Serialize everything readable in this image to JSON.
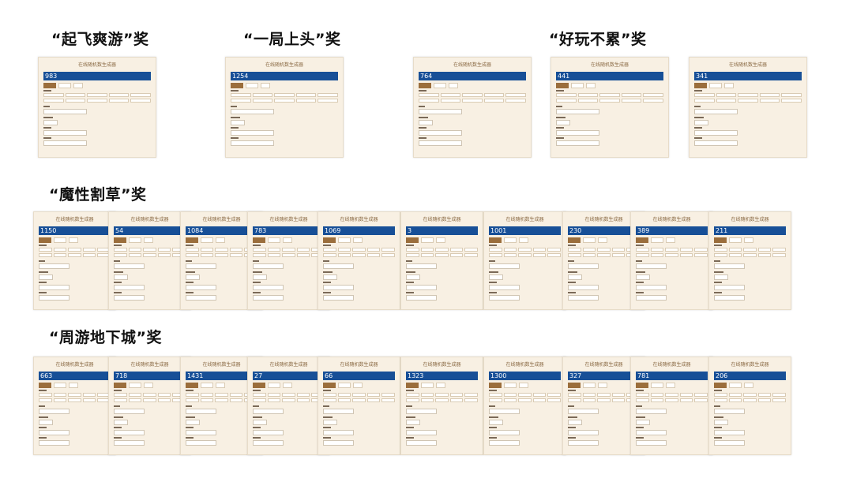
{
  "card_title": "在线随机数生成器",
  "groups": [
    {
      "name": "“起飞爽游”奖",
      "values": [
        "983"
      ]
    },
    {
      "name": "“一局上头”奖",
      "values": [
        "1254"
      ]
    },
    {
      "name": "“好玩不累”奖",
      "values": [
        "764",
        "441",
        "341"
      ]
    },
    {
      "name": "“魔性割草”奖",
      "values": [
        "1150",
        "54",
        "1084",
        "783",
        "1069",
        "3",
        "1001",
        "230",
        "389",
        "211"
      ]
    },
    {
      "name": "“周游地下城”奖",
      "values": [
        "663",
        "718",
        "1431",
        "27",
        "66",
        "1323",
        "1300",
        "327",
        "781",
        "206"
      ]
    }
  ]
}
